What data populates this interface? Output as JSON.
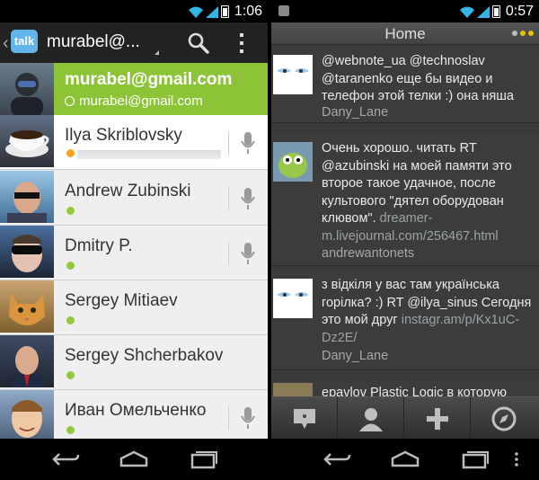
{
  "left": {
    "status_time": "1:06",
    "app_logo_text": "talk",
    "account": "murabel@...",
    "self": {
      "name": "murabel@gmail.com",
      "status": "murabel@gmail.com"
    },
    "contacts": [
      {
        "name": "Ilya Skriblovsky",
        "presence": "away",
        "typing": true
      },
      {
        "name": "Andrew Zubinski",
        "presence": "available"
      },
      {
        "name": "Dmitry P.",
        "presence": "available"
      },
      {
        "name": "Sergey Mitiaev",
        "presence": "available"
      },
      {
        "name": "Sergey Shcherbakov",
        "presence": "available"
      },
      {
        "name": "Иван Омельченко",
        "presence": "available"
      }
    ],
    "icons": {
      "search": "search-icon",
      "overflow": "overflow-menu-icon",
      "mic": "microphone-icon"
    }
  },
  "right": {
    "status_time": "0:57",
    "title": "Home",
    "tweets": [
      {
        "text_parts": [
          "@webnote_ua @technoslav @taranenko еще бы видео и телефон этой телки :) она няша"
        ],
        "link": "",
        "author": "Dany_Lane"
      },
      {
        "text_parts": [
          "Очень хорошо. читать RT @azubinski на моей памяти это второе такое удачное, после культового \"дятел оборудован клювом\". "
        ],
        "link": "dreamer-m.livejournal.com/256467.html",
        "author": "andrewantonets"
      },
      {
        "text_parts": [
          "з відкіля у вас там українська горілка? :) RT @ilya_sinus Сегодня это мой друг "
        ],
        "link": "instagr.am/p/Kx1uC-Dz2E/",
        "author": "Dany_Lane"
      },
      {
        "text_parts": [
          "epavlov Plastic Logic в которую"
        ],
        "link": "",
        "author": ""
      }
    ],
    "tabs": [
      "compose-tweet-icon",
      "profile-icon",
      "add-icon",
      "compass-icon"
    ]
  },
  "colors": {
    "talk_green": "#8dc437",
    "presence_green": "#94c83d",
    "presence_away": "#f7a21b",
    "twitter_bg": "#3c3c3c"
  }
}
